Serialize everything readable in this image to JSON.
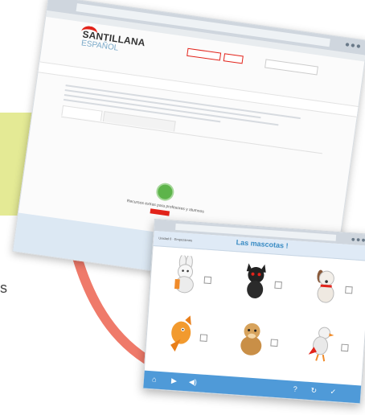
{
  "side_fragment": "s",
  "browser": {
    "logo": {
      "brand": "SANTILLANA",
      "sub": "ESPAÑOL"
    },
    "resource_caption": "Recursos extras para profesores y alumnos"
  },
  "activity": {
    "header_left": "Unidad 0 · Empezamos",
    "title": "Las mascotas !",
    "mascots": [
      "rabbit",
      "black-cat",
      "dog",
      "fish",
      "hamster",
      "parrot"
    ]
  },
  "colors": {
    "accent_red": "#e2231a",
    "accent_blue": "#3a8cc4",
    "activity_bar": "#4f9ad8",
    "highlight_yellow": "#e4ea95",
    "swoosh": "#ef7a6a"
  }
}
